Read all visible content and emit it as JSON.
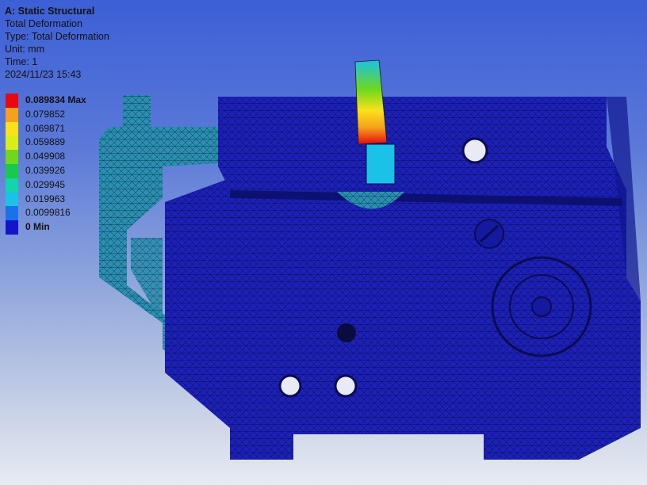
{
  "header": {
    "title": "A: Static Structural",
    "result": "Total Deformation",
    "type_line": "Type: Total Deformation",
    "unit_line": "Unit: mm",
    "time_line": "Time: 1",
    "timestamp": "2024/11/23 15:43"
  },
  "legend": {
    "max_label": "0.089834 Max",
    "min_label": "0 Min",
    "levels": [
      {
        "value": "0.089834 Max",
        "color": "#e8080d"
      },
      {
        "value": "0.079852",
        "color": "#f5a11a"
      },
      {
        "value": "0.069871",
        "color": "#fbe11a"
      },
      {
        "value": "0.059889",
        "color": "#d9ee18"
      },
      {
        "value": "0.049908",
        "color": "#6fd71c"
      },
      {
        "value": "0.039926",
        "color": "#18c94a"
      },
      {
        "value": "0.029945",
        "color": "#15d3ad"
      },
      {
        "value": "0.019963",
        "color": "#1bc1e6"
      },
      {
        "value": "0.0099816",
        "color": "#1a72e8"
      },
      {
        "value": "0 Min",
        "color": "#1414c8"
      }
    ]
  },
  "colors": {
    "mesh_blue": "#1c21b8",
    "mesh_cyan": "#2a8fb0",
    "max_red": "#e8080d"
  }
}
